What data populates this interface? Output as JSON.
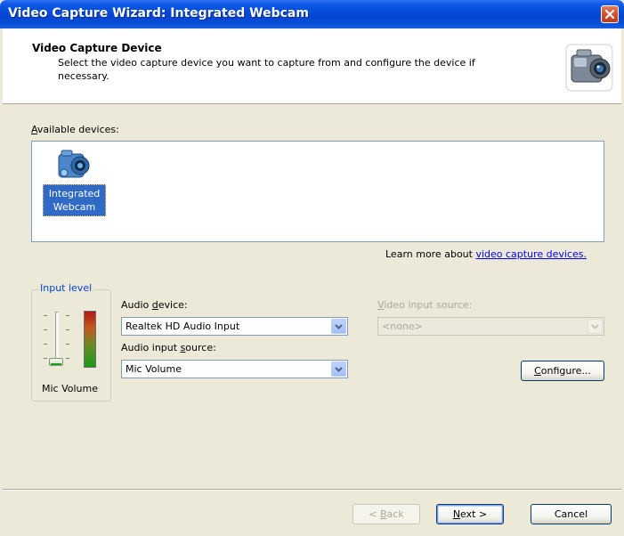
{
  "window": {
    "title": "Video Capture Wizard: Integrated Webcam"
  },
  "header": {
    "title": "Video Capture Device",
    "description": "Select the video capture device you want to capture from and configure the device if necessary."
  },
  "devices": {
    "label_prefix": "",
    "label_mnemonic": "A",
    "label_rest": "vailable devices:",
    "items": [
      {
        "label": "Integrated Webcam"
      }
    ]
  },
  "learn_more": {
    "text": "Learn more about ",
    "link": "video capture devices."
  },
  "input_level": {
    "legend": "Input level",
    "slider_label": "Mic Volume",
    "slider_level": 0.0
  },
  "audio_device": {
    "label_prefix": "Audio ",
    "label_mnemonic": "d",
    "label_rest": "evice:",
    "value": "Realtek HD Audio Input"
  },
  "audio_input_source": {
    "label_prefix": "Audio input ",
    "label_mnemonic": "s",
    "label_rest": "ource:",
    "value": "Mic Volume"
  },
  "video_input_source": {
    "label_prefix": "",
    "label_mnemonic": "V",
    "label_rest": "ideo input source:",
    "value": "<none>"
  },
  "buttons": {
    "configure": {
      "mnemonic": "C",
      "rest": "onfigure..."
    },
    "back": {
      "prefix": "< ",
      "mnemonic": "B",
      "rest": "ack"
    },
    "next": {
      "mnemonic": "N",
      "rest": "ext >"
    },
    "cancel": "Cancel"
  },
  "colors": {
    "title_bar": "#0443d1",
    "selection": "#316ac5",
    "link": "#0000ff",
    "group_legend": "#0046d5"
  }
}
